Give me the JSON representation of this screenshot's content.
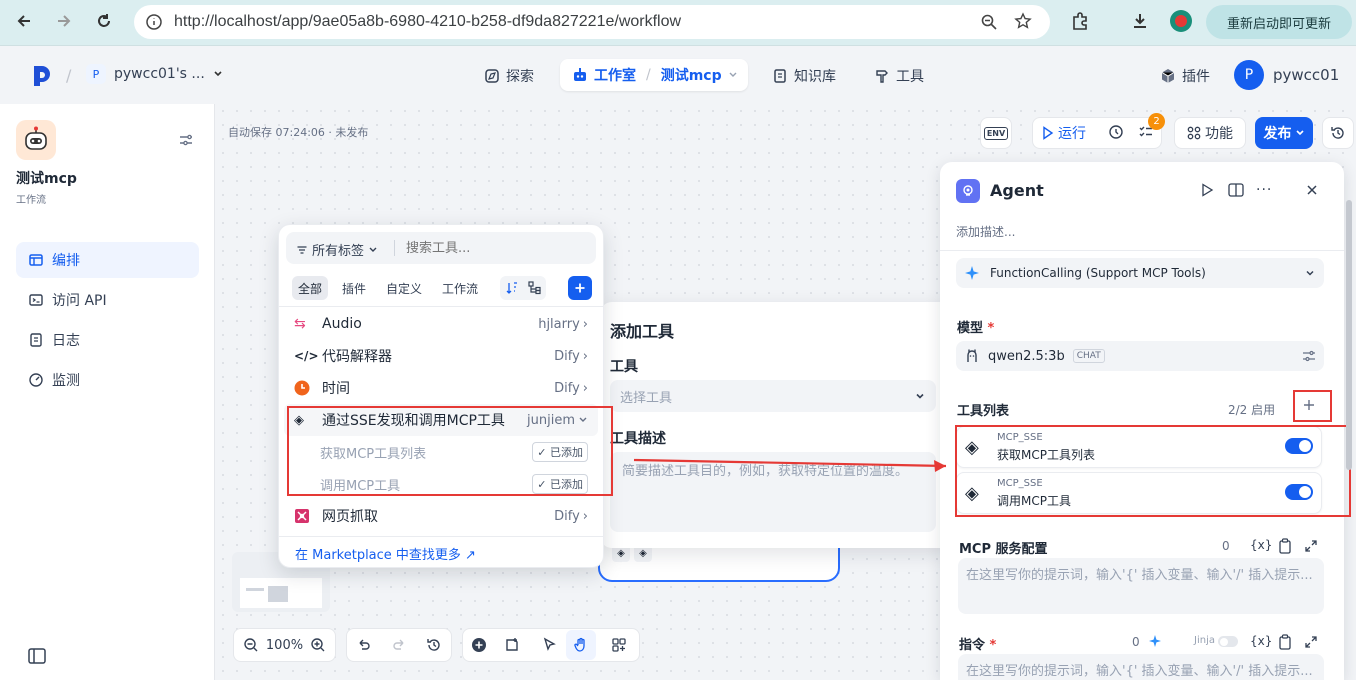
{
  "browser": {
    "url": "http://localhost/app/9ae05a8b-6980-4210-b258-df9da827221e/workflow",
    "restart_label": "重新启动即可更新"
  },
  "header": {
    "workspace_initial": "P",
    "workspace_name": "pywcc01's ...",
    "nav": {
      "explore": "探索",
      "studio": "工作室",
      "app_name": "测试mcp",
      "knowledge": "知识库",
      "tools": "工具",
      "plugins": "插件"
    },
    "user_initial": "P",
    "user_name": "pywcc01"
  },
  "sidebar": {
    "app_name": "测试mcp",
    "app_type": "工作流",
    "items": [
      {
        "label": "编排"
      },
      {
        "label": "访问 API"
      },
      {
        "label": "日志"
      },
      {
        "label": "监测"
      }
    ]
  },
  "canvas_toolbar": {
    "autosave": "自动保存 07:24:06 · 未发布",
    "env": "ENV",
    "run": "运行",
    "badge": "2",
    "features": "功能",
    "publish": "发布",
    "zoom": "100%"
  },
  "picker": {
    "tag_filter": "所有标签",
    "search_placeholder": "搜索工具...",
    "tabs": [
      "全部",
      "插件",
      "自定义",
      "工作流"
    ],
    "tools": [
      {
        "name": "Audio",
        "provider": "hjlarry"
      },
      {
        "name": "代码解释器",
        "provider": "Dify"
      },
      {
        "name": "时间",
        "provider": "Dify"
      },
      {
        "name": "通过SSE发现和调用MCP工具",
        "provider": "junjiem"
      },
      {
        "name": "网页抓取",
        "provider": "Dify"
      }
    ],
    "subtools": [
      {
        "name": "获取MCP工具列表",
        "status": "已添加"
      },
      {
        "name": "调用MCP工具",
        "status": "已添加"
      }
    ],
    "marketplace": "在 Marketplace 中查找更多 ↗"
  },
  "add_tool": {
    "title": "添加工具",
    "tool_label": "工具",
    "tool_placeholder": "选择工具",
    "desc_label": "工具描述",
    "desc_placeholder": "简要描述工具目的，例如，获取特定位置的温度。"
  },
  "agent": {
    "title": "Agent",
    "desc_placeholder": "添加描述...",
    "strategy": "FunctionCalling (Support MCP Tools)",
    "model_label": "模型",
    "model_name": "qwen2.5:3b",
    "model_tag": "CHAT",
    "tools_label": "工具列表",
    "tools_enabled": "2/2 启用",
    "tool_items": [
      {
        "provider": "MCP_SSE",
        "name": "获取MCP工具列表"
      },
      {
        "provider": "MCP_SSE",
        "name": "调用MCP工具"
      }
    ],
    "mcp_config_label": "MCP 服务配置",
    "mcp_config_count": "0",
    "var_icon": "{x}",
    "prompt_placeholder": "在这里写你的提示词，输入'{' 插入变量、输入'/' 插入提示...",
    "instruction_label": "指令",
    "instruction_count": "0",
    "jinja": "Jinja"
  }
}
